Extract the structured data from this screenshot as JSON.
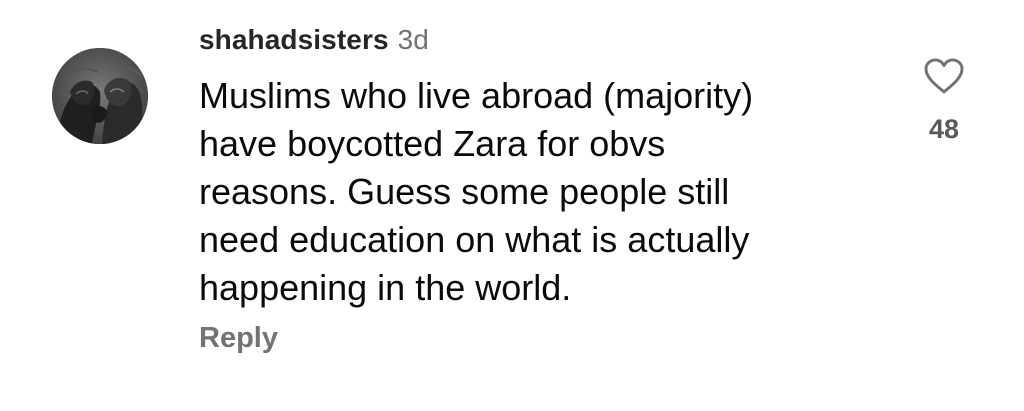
{
  "comment": {
    "username": "shahadsisters",
    "timestamp": "3d",
    "text": "Muslims who live abroad (majority)\nhave boycotted Zara for obvs\nreasons. Guess some people still\nneed education on what is actually\nhappening in the world.",
    "reply_label": "Reply",
    "like_count": "48",
    "like_icon": "heart-outline-icon",
    "avatar": "two-lions-photo"
  },
  "colors": {
    "username": "#262626",
    "secondary_text": "#737373",
    "body_text": "#0a0a0a",
    "like_count": "#595959"
  }
}
